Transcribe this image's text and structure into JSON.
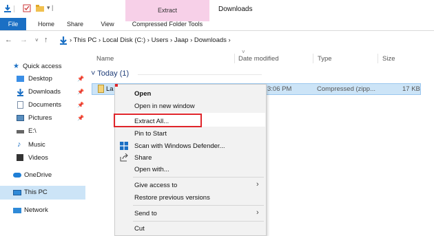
{
  "ribbon": {
    "contextual_tab_title": "Extract",
    "window_title": "Downloads",
    "tabs": [
      "File",
      "Home",
      "Share",
      "View",
      "Compressed Folder Tools"
    ]
  },
  "address": {
    "path": "›  This PC  ›  Local Disk (C:)  ›  Users  ›  Jaap  ›  Downloads  ›"
  },
  "sidebar": {
    "items": [
      {
        "label": "Quick access",
        "icon": "star-icon"
      },
      {
        "label": "Desktop",
        "icon": "desktop-icon",
        "pinned": true
      },
      {
        "label": "Downloads",
        "icon": "download-arrow-icon",
        "pinned": true
      },
      {
        "label": "Documents",
        "icon": "documents-icon",
        "pinned": true
      },
      {
        "label": "Pictures",
        "icon": "pictures-icon",
        "pinned": true
      },
      {
        "label": "E:\\",
        "icon": "drive-icon"
      },
      {
        "label": "Music",
        "icon": "music-icon"
      },
      {
        "label": "Videos",
        "icon": "videos-icon"
      },
      {
        "label": "OneDrive",
        "icon": "cloud-icon"
      },
      {
        "label": "This PC",
        "icon": "computer-icon",
        "selected": true
      },
      {
        "label": "Network",
        "icon": "network-icon"
      }
    ]
  },
  "columns": [
    "Name",
    "Date modified",
    "Type",
    "Size"
  ],
  "group": {
    "label": "Today (1)"
  },
  "file": {
    "name": "La",
    "date": "3:06 PM",
    "type": "Compressed (zipp...",
    "size": "17 KB"
  },
  "context_menu": {
    "items": [
      "Open",
      "Open in new window",
      "Extract All...",
      "Pin to Start",
      "Scan with Windows Defender...",
      "Share",
      "Open with...",
      "Give access to",
      "Restore previous versions",
      "Send to",
      "Cut"
    ]
  },
  "colors": {
    "accent": "#1a6fc4",
    "highlight": "#cce4f7",
    "red_box": "#e0242a",
    "contextual_tab": "#f7d0e8"
  }
}
